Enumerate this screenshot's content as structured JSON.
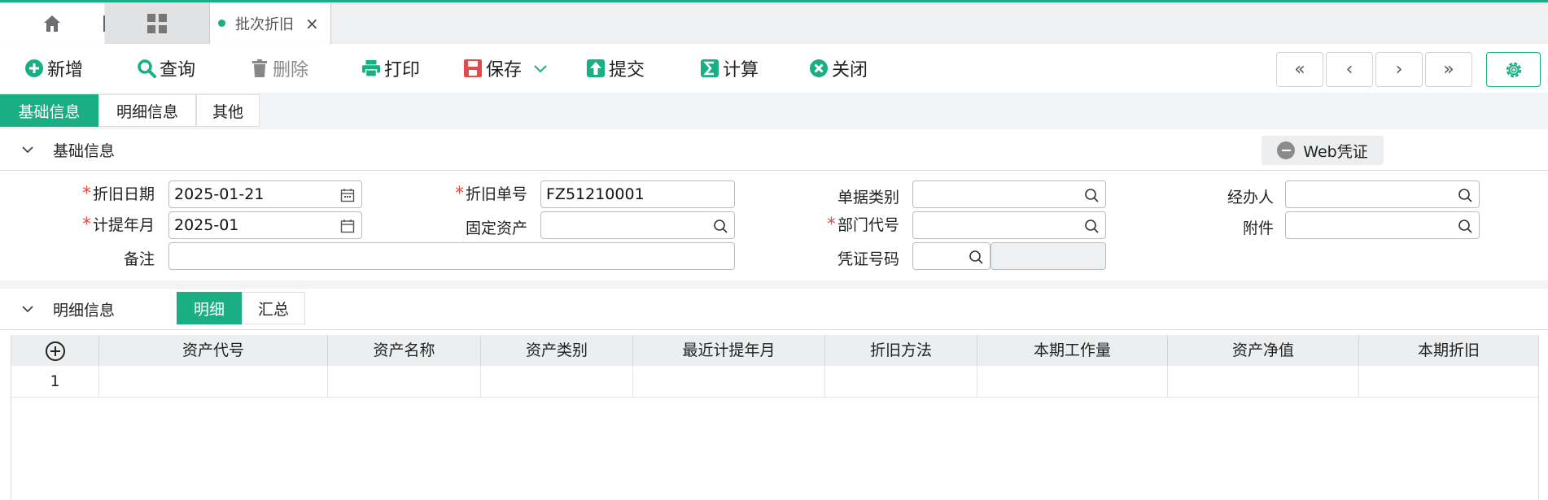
{
  "colors": {
    "accent": "#1aae84",
    "required": "#e34a4a",
    "print": "#1aae84",
    "save": "#e34a4a"
  },
  "tabs": {
    "home_icon": "home-icon",
    "grid_icon": "grid-icon",
    "active_label": "批次折旧",
    "close_glyph": "×"
  },
  "toolbar": {
    "add_label": "新增",
    "query_label": "查询",
    "delete_label": "删除",
    "print_label": "打印",
    "save_label": "保存",
    "submit_label": "提交",
    "calc_label": "计算",
    "close_label": "关闭",
    "nav_first": "«",
    "nav_prev": "‹",
    "nav_next": "›",
    "nav_last": "»"
  },
  "section_tabs": [
    "基础信息",
    "明细信息",
    "其他"
  ],
  "basic": {
    "title": "基础信息",
    "web_voucher": "Web凭证",
    "fields": {
      "dep_date_label": "折旧日期",
      "dep_date_value": "2025-01-21",
      "dep_no_label": "折旧单号",
      "dep_no_value": "FZ51210001",
      "doc_type_label": "单据类别",
      "handler_label": "经办人",
      "accrual_month_label": "计提年月",
      "accrual_month_value": "2025-01",
      "fixed_asset_label": "固定资产",
      "dept_code_label": "部门代号",
      "attachment_label": "附件",
      "remark_label": "备注",
      "voucher_no_label": "凭证号码"
    }
  },
  "detail": {
    "title": "明细信息",
    "tabs": [
      "明细",
      "汇总"
    ],
    "columns": [
      "资产代号",
      "资产名称",
      "资产类别",
      "最近计提年月",
      "折旧方法",
      "本期工作量",
      "资产净值",
      "本期折旧"
    ],
    "rows": [
      {
        "index": "1"
      }
    ]
  }
}
